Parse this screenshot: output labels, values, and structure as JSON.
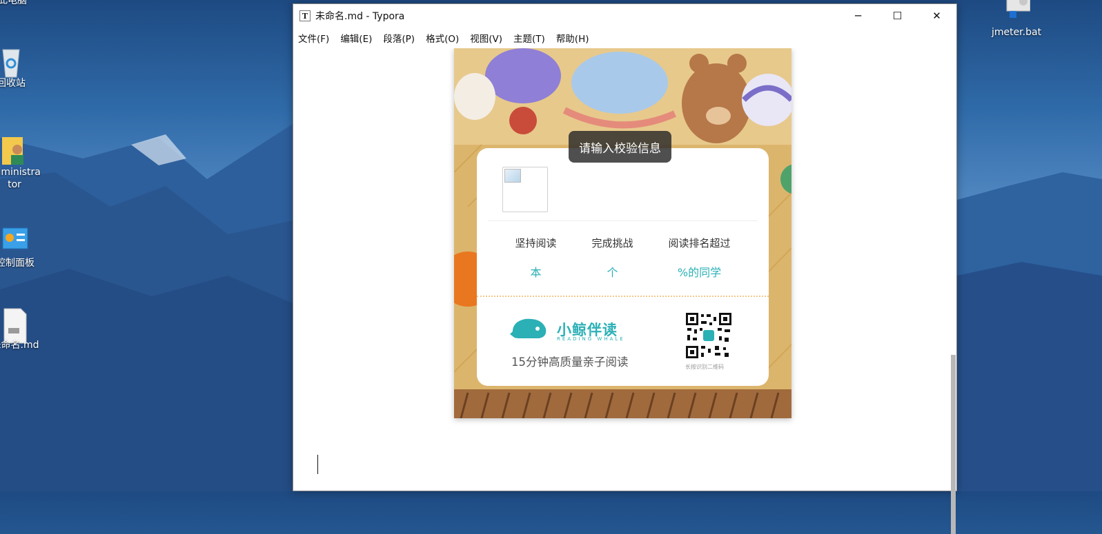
{
  "desktop": {
    "icons": [
      {
        "label": "此电脑"
      },
      {
        "label": "回收站"
      },
      {
        "label": "Administrator"
      },
      {
        "label": "控制面板"
      },
      {
        "label": "未命名.md"
      },
      {
        "label": "jmeter.bat"
      }
    ]
  },
  "window": {
    "title": "未命名.md - Typora",
    "app_icon": "T",
    "controls": {
      "minimize": "─",
      "maximize": "☐",
      "close": "✕"
    }
  },
  "menu": [
    "文件(F)",
    "编辑(E)",
    "段落(P)",
    "格式(O)",
    "视图(V)",
    "主题(T)",
    "帮助(H)"
  ],
  "poster": {
    "toast": "请输入校验信息",
    "stats": [
      {
        "label": "坚持阅读",
        "unit": "本"
      },
      {
        "label": "完成挑战",
        "unit": "个"
      },
      {
        "label": "阅读排名超过",
        "unit": "%的同学"
      }
    ],
    "brand_name": "小鲸伴读",
    "brand_subtitle": "READING WHALE",
    "tagline": "15分钟高质量亲子阅读",
    "qr_caption": "长按识别二维码"
  },
  "colors": {
    "accent": "#2bb0b6",
    "poster_bg": "#d9b26a"
  }
}
